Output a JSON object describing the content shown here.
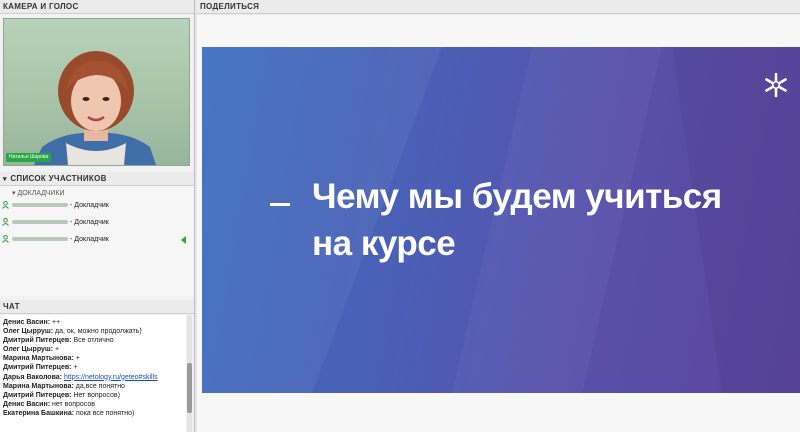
{
  "camera_panel": {
    "title": "КАМЕРА И ГОЛОС",
    "speaker_tag": "Наталья Шарова"
  },
  "participants_panel": {
    "title": "СПИСОК УЧАСТНИКОВ",
    "group_label": "ДОКЛАДЧИКИ",
    "items": [
      {
        "role": "- Докладчик",
        "mic_active": false
      },
      {
        "role": "- Докладчик",
        "mic_active": false
      },
      {
        "role": "- Докладчик",
        "mic_active": true
      }
    ]
  },
  "chat_panel": {
    "title": "ЧАТ",
    "messages": [
      {
        "author": "Денис Васин:",
        "text": "++"
      },
      {
        "author": "Олег Цырруш:",
        "text": "да, ок, можно продолжать)"
      },
      {
        "author": "Дмитрий Питерцев:",
        "text": "Все отлично"
      },
      {
        "author": "Олег Цырруш:",
        "text": "+"
      },
      {
        "author": "Марина Мартынова:",
        "text": "+"
      },
      {
        "author": "Дмитрий Питерцев:",
        "text": "+"
      },
      {
        "author": "Дарья Ваколова:",
        "text": "https://netology.ru/geteo#skills",
        "is_link": true
      },
      {
        "author": "Марина Мартынова:",
        "text": "да,все понятно"
      },
      {
        "author": "Дмитрий Питерцев:",
        "text": "Нет вопросов)"
      },
      {
        "author": "Денис Васин:",
        "text": "нет вопросов"
      },
      {
        "author": "Екатерина Башкина:",
        "text": "пока все понятно)"
      }
    ]
  },
  "share_panel": {
    "title": "ПОДЕЛИТЬСЯ",
    "slide": {
      "dash": "_",
      "title": "Чему мы будем учиться на курсе",
      "logo_icon": "snowflake-logo-icon"
    }
  },
  "colors": {
    "slide_start": "#3d6fbf",
    "slide_end": "#5a469f",
    "mic_green": "#27a843",
    "link": "#1a4fbf"
  }
}
